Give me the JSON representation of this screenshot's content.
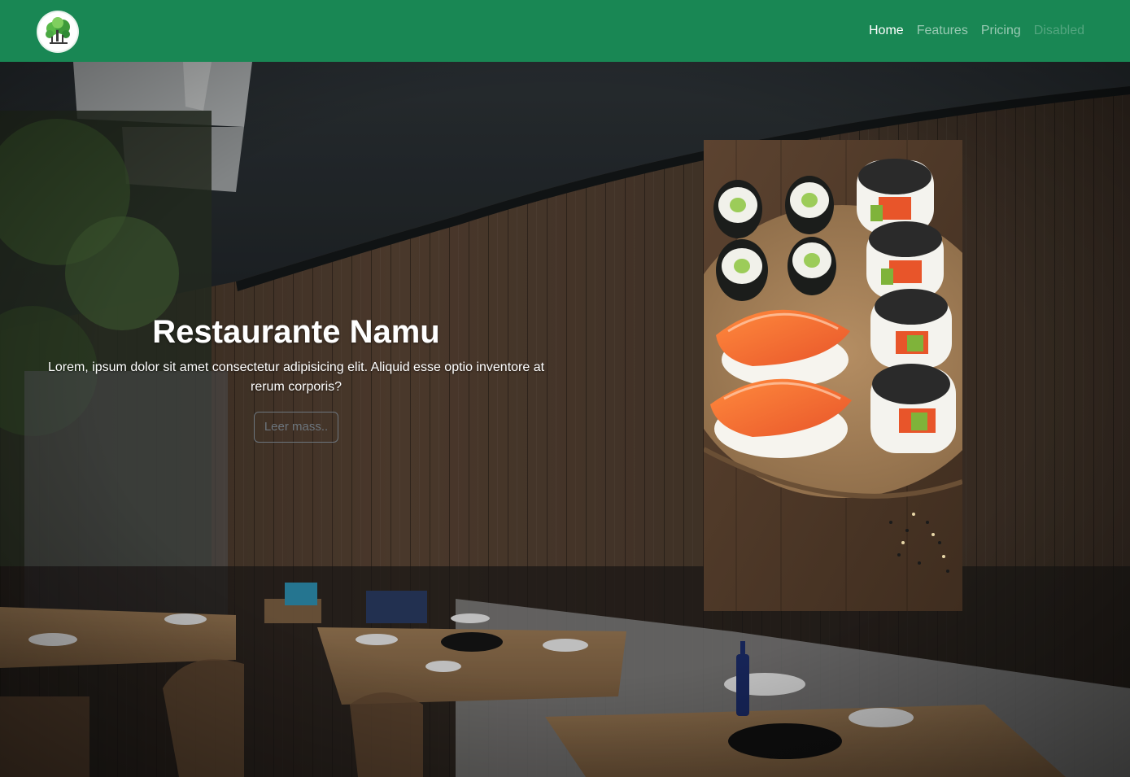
{
  "navbar": {
    "logo_name": "tree-logo",
    "links": [
      {
        "label": "Home",
        "state": "active"
      },
      {
        "label": "Features",
        "state": "normal"
      },
      {
        "label": "Pricing",
        "state": "normal"
      },
      {
        "label": "Disabled",
        "state": "disabled"
      }
    ]
  },
  "hero": {
    "title": "Restaurante Namu",
    "description": "Lorem, ipsum dolor sit amet consectetur adipisicing elit. Aliquid esse optio inventore at rerum corporis?",
    "button_label": "Leer mass.."
  },
  "colors": {
    "navbar_bg": "#198754",
    "button_border": "#6c757d"
  }
}
